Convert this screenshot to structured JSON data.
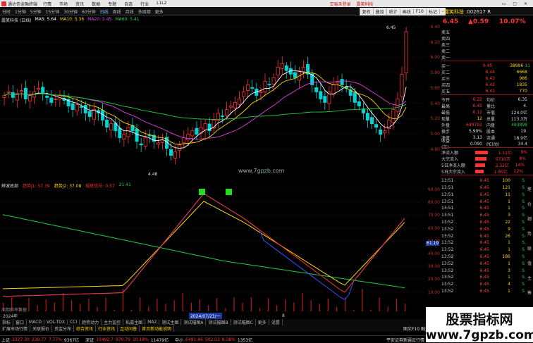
{
  "titlebar": {
    "app_name": "通达信金融终端",
    "menus": [
      "行情",
      "市场",
      "资讯",
      "数据",
      "专题",
      "自选",
      "行业",
      "L1L2"
    ],
    "notice1": "交易未登录",
    "notice2": "露笑科技"
  },
  "toolbar": {
    "periods": [
      "分时",
      "1分钟",
      "5分钟",
      "15分钟",
      "30分钟",
      "60分钟",
      "日线",
      "周线",
      "月线",
      "多周期",
      "更多"
    ],
    "active_period": "日线",
    "right_tools": [
      "复权",
      "叠加",
      "统计",
      "画线",
      "F10",
      "标记",
      "-"
    ],
    "chart_title": "露笑科技 (日线)",
    "ma_labels": [
      "MA5: 5.64",
      "MA10: 5.36",
      "MA20: 5.45",
      "MA60: 5.41"
    ]
  },
  "price_axis": [
    "6.40",
    "6.20",
    "6.00",
    "5.80",
    "5.60",
    "5.40",
    "5.20",
    "5.00",
    "4.80"
  ],
  "indicator_axis": [
    "90.00",
    "80.00",
    "70.00",
    "60.00",
    "50.00",
    "40.00",
    "30.00",
    "20.00",
    "10.00"
  ],
  "annotations": {
    "high_label": "6.45",
    "low_label": "4.48",
    "watermark_mid": "www.7gpzb.com",
    "ind_right_val": "61.19"
  },
  "indicator": {
    "title": "辨波底部",
    "line1": "趋势J1: 57.39",
    "line2": "趋势J2: 37.08",
    "line3": "掘底信号: 0.57",
    "extra": "21.41"
  },
  "bottom_bar": {
    "vol_note": "周期斜率数据",
    "date_highlight": "2024/07/23/一",
    "year_left": "2024年",
    "month_mark": "8",
    "tabs": [
      "指标",
      "窗口",
      "MACD",
      "VOL-TDX",
      "CCI",
      "趋势动力",
      "主力监控",
      "私募主图",
      "MA2",
      "测试主图",
      "测试幅图A",
      "测试幅图B",
      "测试幅图C",
      "更多",
      "设置"
    ],
    "tabs2": [
      "扩展市场行情",
      "关联报价",
      "资金分布",
      "综合资讯",
      "行业资讯",
      "互动问答",
      "首页新动能说明"
    ],
    "right_note": "图文F10 融资"
  },
  "stock": {
    "name": "露笑科技",
    "code": "002617",
    "mark": "R",
    "price": "6.45",
    "change": "▲0.59",
    "pct": "10.07%"
  },
  "orderbook": {
    "sells": [
      {
        "label": "卖五",
        "price": "",
        "vol": ""
      },
      {
        "label": "卖四",
        "price": "",
        "vol": ""
      },
      {
        "label": "卖三",
        "price": "",
        "vol": ""
      },
      {
        "label": "卖二",
        "price": "",
        "vol": ""
      },
      {
        "label": "卖一",
        "price": "",
        "vol": ""
      }
    ],
    "buys": [
      {
        "label": "买一",
        "price": "6.45",
        "vol": "38996",
        "extra": "-11"
      },
      {
        "label": "买二",
        "price": "6.44",
        "vol": "6668",
        "extra": ""
      },
      {
        "label": "买三",
        "price": "6.43",
        "vol": "986",
        "extra": ""
      },
      {
        "label": "买四",
        "price": "6.42",
        "vol": "1835",
        "extra": ""
      },
      {
        "label": "买五",
        "price": "6.41",
        "vol": "770",
        "extra": ""
      }
    ]
  },
  "quote": [
    {
      "k1": "今开",
      "v1": "6.22",
      "k2": "均价",
      "v2": "6.35"
    },
    {
      "k1": "最高",
      "v1": "6.45",
      "k2": "量比",
      "v2": "4."
    },
    {
      "k1": "最低",
      "v1": "6.12",
      "k2": "市值",
      "v2": "124.0亿"
    },
    {
      "k1": "现量",
      "v1": "12",
      "k2": "总量",
      "v2": "113.3万"
    },
    {
      "k1": "外盘",
      "v1": "649792",
      "k2": "内盘",
      "v2": "483898"
    },
    {
      "k1": "换手",
      "v1": "5.99%",
      "k2": "股本",
      "v2": "19."
    },
    {
      "k1": "净资",
      "v1": "3.13",
      "k2": "流通",
      "v2": "18.9亿"
    },
    {
      "k1": "收益(三)",
      "v1": "0.090",
      "k2": "PE(动)",
      "v2": "34.4"
    }
  ],
  "flows": [
    {
      "k": "净流入额",
      "v": "1.11亿",
      "p": "9%"
    },
    {
      "k": "大宗流入",
      "v": "5710万",
      "p": "8%"
    },
    {
      "k": "5日净流入额",
      "v": "2.32亿",
      "p": "14%"
    },
    {
      "k": "5日大宗流入",
      "v": "1.95亿",
      "p": "12%"
    }
  ],
  "ticks": [
    {
      "t": "13:51",
      "p": "6.45",
      "v": "100",
      "s": "S"
    },
    {
      "t": "13:51",
      "p": "6.45",
      "v": "121",
      "s": "S"
    },
    {
      "t": "13:51",
      "p": "6.45",
      "v": "11",
      "s": "S"
    },
    {
      "t": "13:51",
      "p": "6.45",
      "v": "1",
      "s": "S"
    },
    {
      "t": "13:51",
      "p": "6.45",
      "v": "1",
      "s": "S"
    },
    {
      "t": "13:51",
      "p": "6.45",
      "v": "3",
      "s": "S"
    },
    {
      "t": "13:52",
      "p": "6.45",
      "v": "22",
      "s": "S"
    },
    {
      "t": "13:52",
      "p": "6.45",
      "v": "9",
      "s": "S"
    },
    {
      "t": "13:52",
      "p": "6.45",
      "v": "26",
      "s": "S"
    },
    {
      "t": "13:52",
      "p": "6.45",
      "v": "1",
      "s": "S"
    },
    {
      "t": "13:52",
      "p": "6.45",
      "v": "1",
      "s": "S"
    },
    {
      "t": "13:52",
      "p": "6.45",
      "v": "186",
      "s": "S"
    },
    {
      "t": "13:52",
      "p": "6.45",
      "v": "1",
      "s": "S"
    },
    {
      "t": "13:52",
      "p": "6.45",
      "v": "3",
      "s": "S"
    },
    {
      "t": "13:52",
      "p": "6.45",
      "v": "1",
      "s": "S"
    },
    {
      "t": "13:52",
      "p": "6.45",
      "v": "4",
      "s": "S"
    },
    {
      "t": "13:52",
      "p": "6.45",
      "v": "1",
      "s": "S"
    }
  ],
  "panel_tabs": [
    "笔",
    "价",
    "细",
    "势",
    "联",
    "值",
    "主",
    "筹"
  ],
  "status": {
    "idx1_name": "上证",
    "idx1_val": "3327.30",
    "idx1_chg": "239.77",
    "idx1_pct": "7.77%",
    "idx1_amt": "9367亿",
    "idx2_name": "深证",
    "idx2_val": "10492.7",
    "idx2_chg": "970.79",
    "idx2_pct": "10.18%",
    "idx2_amt": "11479亿",
    "idx3_name": "中小",
    "idx3_val": "6491.46",
    "idx3_chg": "502.03",
    "idx3_pct": "8.38%",
    "idx3_amt": "1353亿",
    "right_msg": "平安证券新疆云行情"
  },
  "watermark_big": {
    "line1": "股票指标网",
    "line2": "www.7gpzb.com"
  },
  "colors": {
    "up": "#ff3333",
    "down": "#22cc44",
    "bg": "#000000",
    "ma5": "#ffffff",
    "ma10": "#ffd700",
    "ma20": "#e040e0",
    "ma60": "#22cc44"
  }
}
